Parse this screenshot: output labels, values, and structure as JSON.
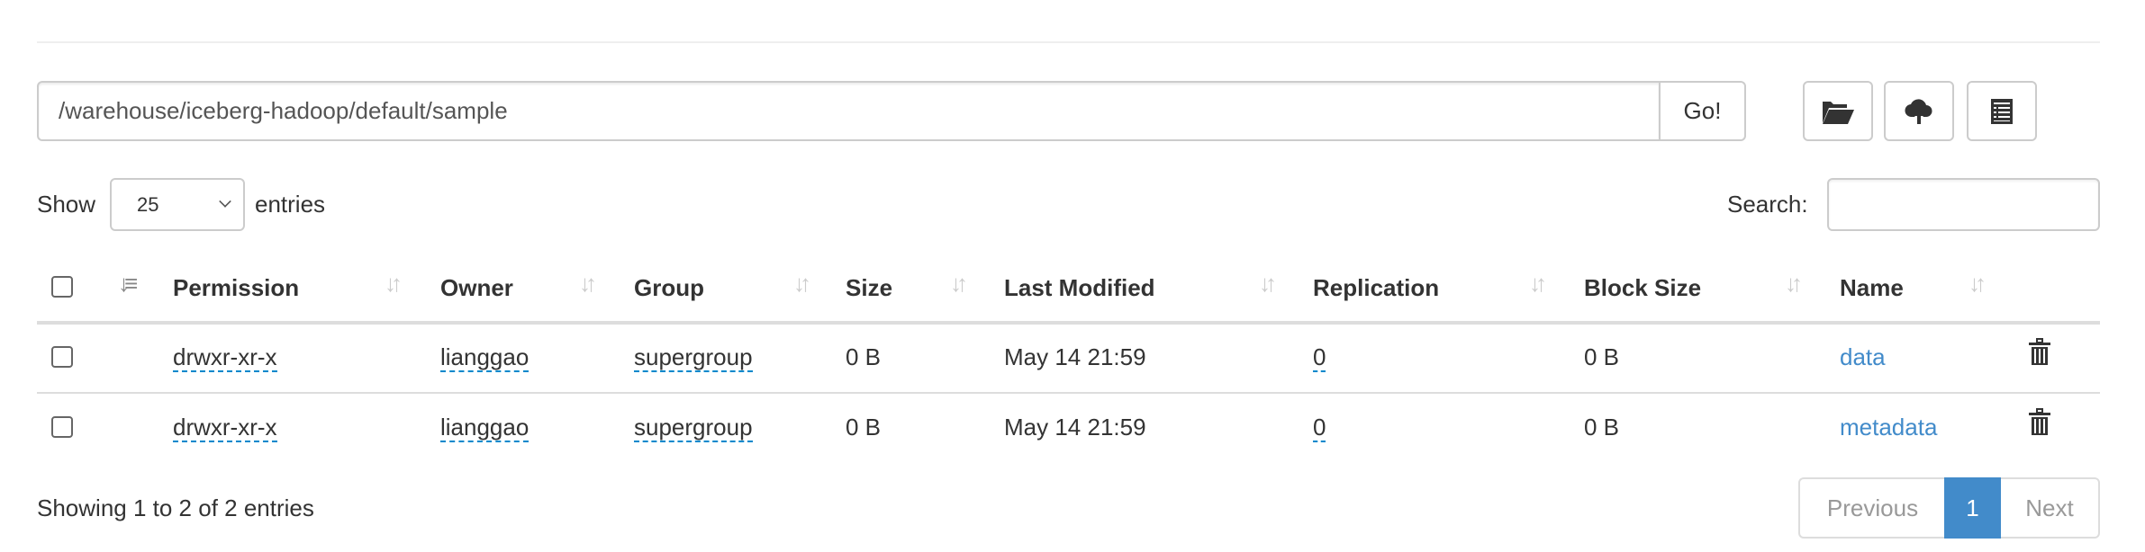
{
  "path_bar": {
    "value": "/warehouse/iceberg-hadoop/default/sample",
    "go_label": "Go!"
  },
  "toolbar": {
    "icons": [
      "folder-open-icon",
      "cloud-upload-icon",
      "list-alt-icon"
    ]
  },
  "length": {
    "show_label": "Show",
    "selected": "25",
    "entries_label": "entries"
  },
  "search": {
    "label": "Search:",
    "value": ""
  },
  "table": {
    "columns": [
      "Permission",
      "Owner",
      "Group",
      "Size",
      "Last Modified",
      "Replication",
      "Block Size",
      "Name"
    ],
    "rows": [
      {
        "permission": "drwxr-xr-x",
        "owner": "lianggao",
        "group": "supergroup",
        "size": "0 B",
        "modified": "May 14 21:59",
        "replication": "0",
        "block_size": "0 B",
        "name": "data"
      },
      {
        "permission": "drwxr-xr-x",
        "owner": "lianggao",
        "group": "supergroup",
        "size": "0 B",
        "modified": "May 14 21:59",
        "replication": "0",
        "block_size": "0 B",
        "name": "metadata"
      }
    ]
  },
  "footer": {
    "info": "Showing 1 to 2 of 2 entries"
  },
  "pagination": {
    "previous": "Previous",
    "current": "1",
    "next": "Next"
  },
  "colors": {
    "link": "#428bca",
    "active_page": "#428bca",
    "dashed_underline": "#0088cc"
  }
}
